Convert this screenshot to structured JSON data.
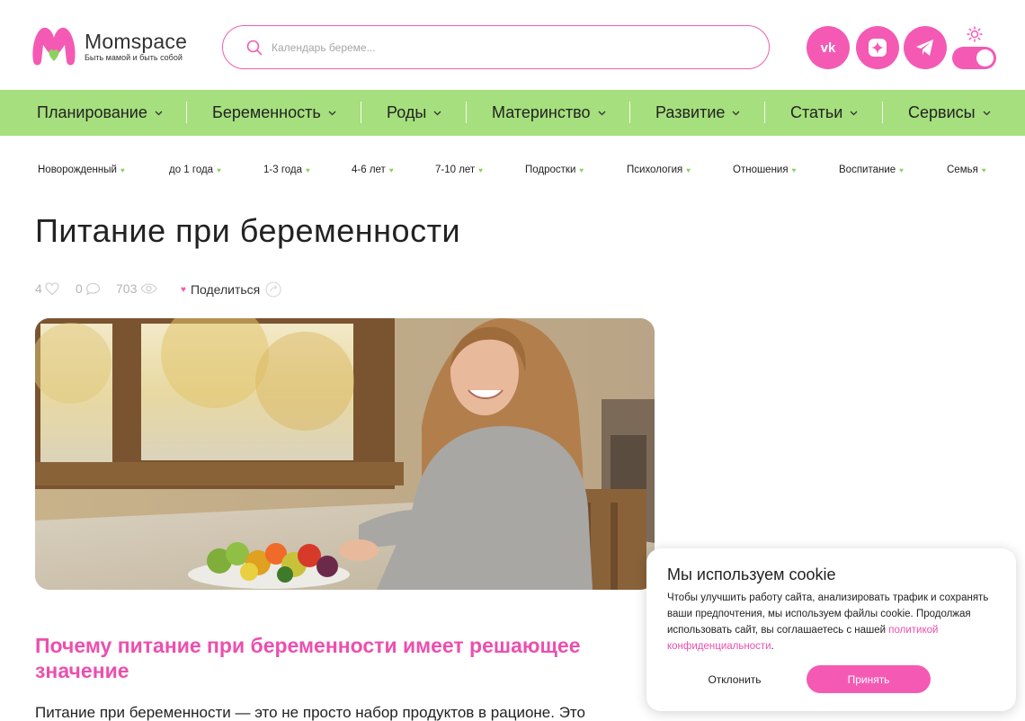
{
  "header": {
    "logo_name": "Momspace",
    "logo_tagline": "Быть мамой и быть собой",
    "search_placeholder": "Календарь береме...",
    "social": [
      "vk-icon",
      "dzen-icon",
      "telegram-icon"
    ],
    "theme_toggle": "on"
  },
  "mainnav": [
    {
      "label": "Планирование"
    },
    {
      "label": "Беременность"
    },
    {
      "label": "Роды"
    },
    {
      "label": "Материнство"
    },
    {
      "label": "Развитие"
    },
    {
      "label": "Статьи"
    },
    {
      "label": "Сервисы"
    }
  ],
  "subnav": [
    {
      "label": "Новорожденный"
    },
    {
      "label": "до 1 года"
    },
    {
      "label": "1-3 года"
    },
    {
      "label": "4-6 лет"
    },
    {
      "label": "7-10 лет"
    },
    {
      "label": "Подростки"
    },
    {
      "label": "Психология"
    },
    {
      "label": "Отношения"
    },
    {
      "label": "Воспитание"
    },
    {
      "label": "Семья"
    }
  ],
  "article": {
    "title": "Питание при беременности",
    "likes": "4",
    "comments": "0",
    "views": "703",
    "share_label": "Поделиться",
    "heading": "Почему питание при беременности имеет решающее значение",
    "text": "Питание при беременности — это не просто набор продуктов в рационе. Это"
  },
  "cookie": {
    "title": "Мы используем cookie",
    "body": "Чтобы улучшить работу сайта, анализировать трафик и сохранять ваши предпочтения, мы используем файлы cookie. Продолжая использовать сайт, вы соглашаетесь с нашей",
    "link": "политикой конфиденциальности",
    "link_suffix": ".",
    "decline": "Отклонить",
    "accept": "Принять"
  },
  "colors": {
    "accent_pink": "#f45ab4",
    "nav_green": "#a6df7d",
    "heading_pink": "#ec4fae"
  }
}
